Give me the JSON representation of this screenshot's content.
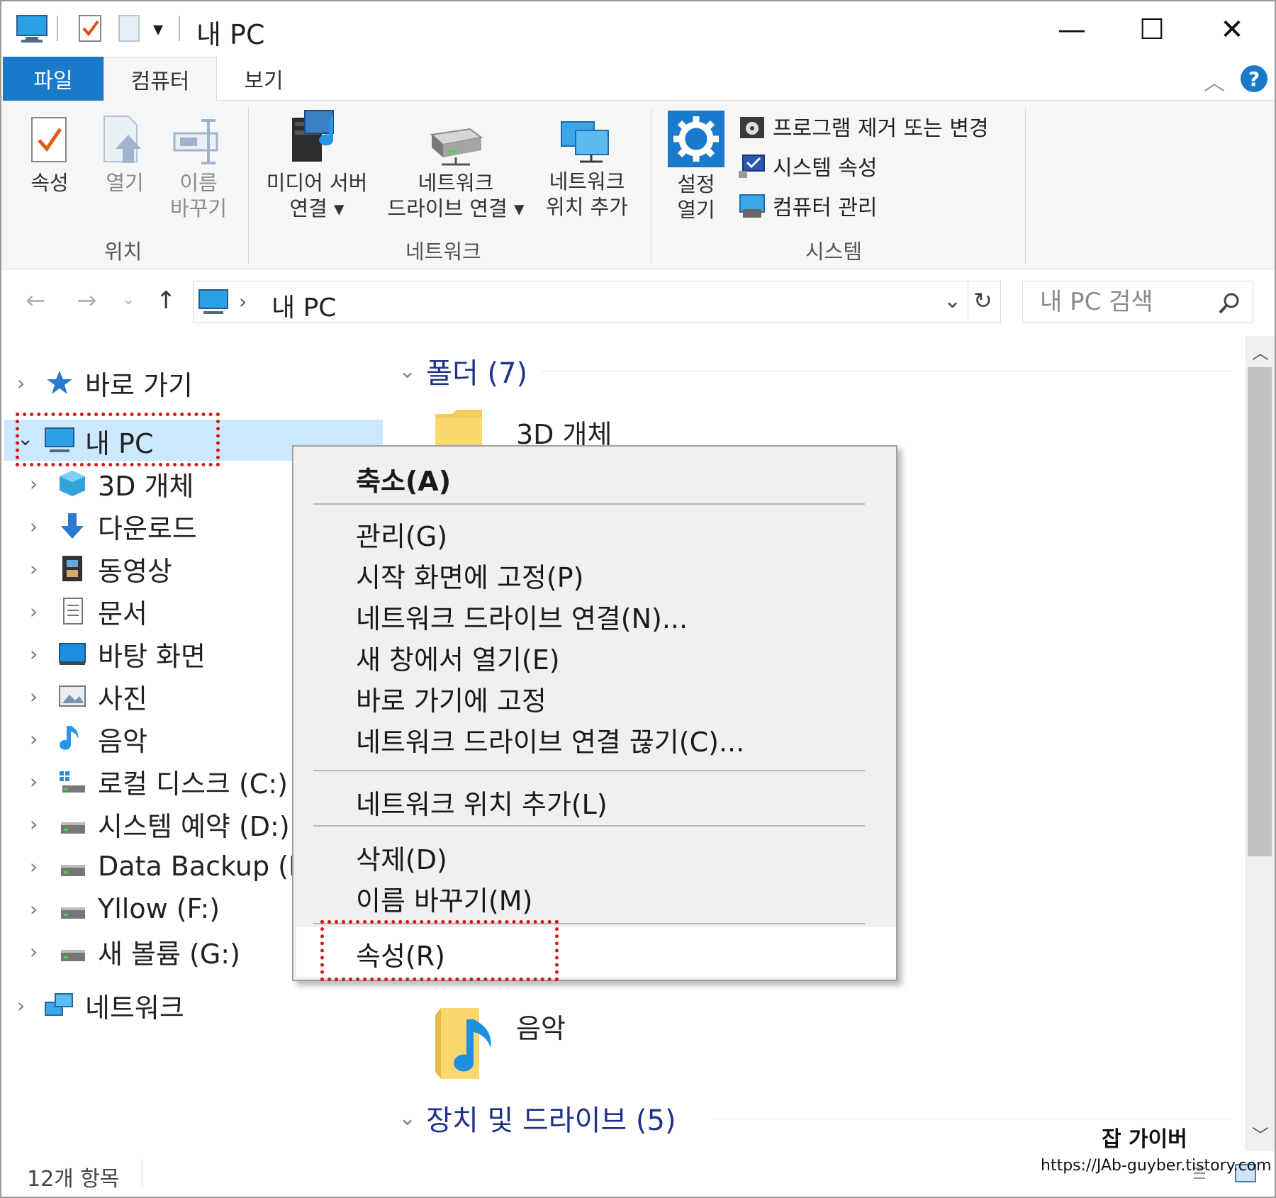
{
  "window": {
    "title": "내 PC",
    "controls": [
      "—",
      "☐",
      "✕"
    ]
  },
  "ribbon": {
    "tabs": {
      "file": "파일",
      "computer": "컴퓨터",
      "view": "보기"
    },
    "location": {
      "group_label": "위치",
      "properties": "속성",
      "open": "열기",
      "rename_line1": "이름",
      "rename_line2": "바꾸기"
    },
    "network": {
      "group_label": "네트워크",
      "media_line1": "미디어 서버",
      "media_line2": "연결 ▾",
      "netdrive_line1": "네트워크",
      "netdrive_line2": "드라이브 연결 ▾",
      "netloc_line1": "네트워크",
      "netloc_line2": "위치 추가"
    },
    "system": {
      "group_label": "시스템",
      "settings_line1": "설정",
      "settings_line2": "열기",
      "uninstall": "프로그램 제거 또는 변경",
      "sysprops": "시스템 속성",
      "manage": "컴퓨터 관리"
    }
  },
  "address": {
    "path": "내 PC",
    "search_placeholder": "내 PC 검색"
  },
  "nav": {
    "quick_access": "바로 가기",
    "this_pc": "내 PC",
    "items": [
      "3D 개체",
      "다운로드",
      "동영상",
      "문서",
      "바탕 화면",
      "사진",
      "음악",
      "로컬 디스크 (C:)",
      "시스템 예약 (D:)",
      "Data Backup (E:)",
      "Yllow (F:)",
      "새 볼륨 (G:)"
    ],
    "network": "네트워크"
  },
  "content": {
    "folders_header": "폴더 (7)",
    "folder_first": "3D 개체",
    "folder_music": "음악",
    "devices_header": "장치 및 드라이브 (5)"
  },
  "context_menu": {
    "collapse": "축소(A)",
    "manage": "관리(G)",
    "pin_start": "시작 화면에 고정(P)",
    "map_drive": "네트워크 드라이브 연결(N)...",
    "open_new": "새 창에서 열기(E)",
    "pin_quick": "바로 가기에 고정",
    "disconnect": "네트워크 드라이브 연결 끊기(C)...",
    "add_netloc": "네트워크 위치 추가(L)",
    "delete": "삭제(D)",
    "rename": "이름 바꾸기(M)",
    "properties": "속성(R)"
  },
  "status": {
    "count": "12개 항목"
  },
  "watermark": {
    "name": "잡 가이버",
    "url": "https://JAb-guyber.tistory.com"
  },
  "colors": {
    "accent": "#1979ca",
    "selection": "#cce8ff",
    "highlight": "#d01818",
    "section": "#1e3287"
  }
}
